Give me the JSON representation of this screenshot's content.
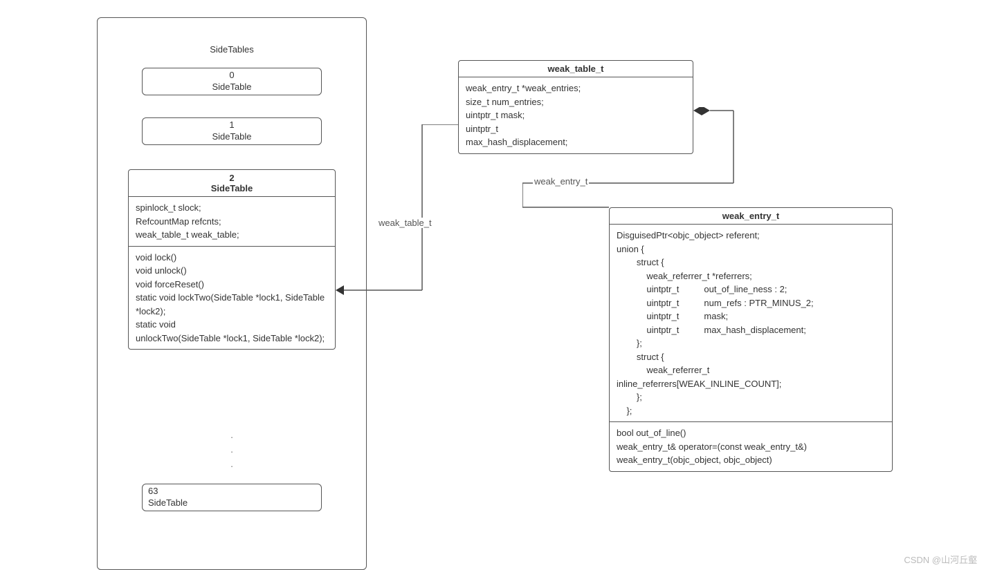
{
  "sidetables": {
    "title": "SideTables",
    "items": [
      {
        "index": "0",
        "label": "SideTable"
      },
      {
        "index": "1",
        "label": "SideTable"
      }
    ],
    "detailed": {
      "index": "2",
      "title": "SideTable",
      "fields": "spinlock_t slock;\nRefcountMap refcnts;\nweak_table_t weak_table;",
      "methods": "void lock()\nvoid unlock()\nvoid forceReset()\nstatic void lockTwo(SideTable *lock1, SideTable *lock2);\nstatic void\nunlockTwo(SideTable *lock1, SideTable *lock2);"
    },
    "last": {
      "index": "63",
      "label": "SideTable"
    },
    "ellipsis": ".\n.\n."
  },
  "weak_table": {
    "title": "weak_table_t",
    "body": "weak_entry_t *weak_entries;\nsize_t    num_entries;\nuintptr_t mask;\nuintptr_t\nmax_hash_displacement;"
  },
  "weak_entry": {
    "title": "weak_entry_t",
    "fields": "DisguisedPtr<objc_object> referent;\nunion {\n        struct {\n            weak_referrer_t *referrers;\n            uintptr_t          out_of_line_ness : 2;\n            uintptr_t          num_refs : PTR_MINUS_2;\n            uintptr_t          mask;\n            uintptr_t          max_hash_displacement;\n        };\n        struct {\n            weak_referrer_t\ninline_referrers[WEAK_INLINE_COUNT];\n        };\n    };",
    "methods": "bool out_of_line()\nweak_entry_t& operator=(const weak_entry_t&)\nweak_entry_t(objc_object, objc_object)"
  },
  "labels": {
    "weak_table": "weak_table_t",
    "weak_entry": "weak_entry_t"
  },
  "watermark": "CSDN @山河丘壑"
}
